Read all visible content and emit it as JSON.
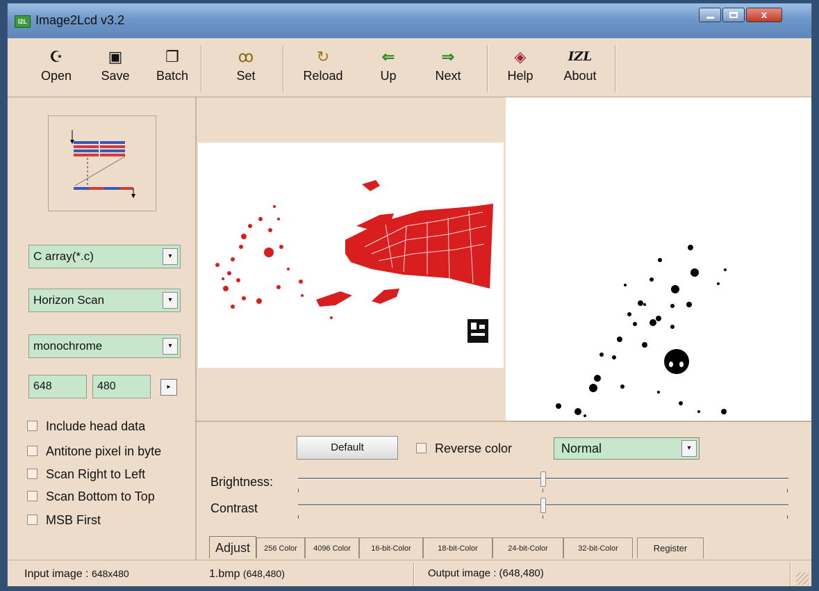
{
  "window": {
    "title": "Image2Lcd v3.2",
    "icon_text": "I2L",
    "close_glyph": "x"
  },
  "toolbar": {
    "buttons": [
      {
        "label": "Open",
        "icon": "open-icon",
        "glyph": "☪"
      },
      {
        "label": "Save",
        "icon": "save-icon",
        "glyph": "▣"
      },
      {
        "label": "Batch",
        "icon": "batch-icon",
        "glyph": "❐"
      },
      {
        "label": "Set",
        "icon": "glasses-icon",
        "glyph": "ꝏ"
      },
      {
        "label": "Reload",
        "icon": "reload-icon",
        "glyph": "↻"
      },
      {
        "label": "Up",
        "icon": "arrow-left-icon",
        "glyph": "⇐"
      },
      {
        "label": "Next",
        "icon": "arrow-right-icon",
        "glyph": "⇒"
      },
      {
        "label": "Help",
        "icon": "help-book-icon",
        "glyph": "◈"
      },
      {
        "label": "About",
        "icon": "about-logo-icon",
        "glyph": "IZL"
      }
    ]
  },
  "left_panel": {
    "output_type": "C array(*.c)",
    "scan_mode": "Horizon Scan",
    "color_depth": "monochrome",
    "width_value": "648",
    "height_value": "480",
    "checkboxes": [
      {
        "label": "Include head data",
        "checked": false
      },
      {
        "label": "Antitone pixel in byte",
        "checked": false
      },
      {
        "label": "Scan Right to Left",
        "checked": false
      },
      {
        "label": "Scan Bottom to Top",
        "checked": false
      },
      {
        "label": "MSB First",
        "checked": false
      }
    ],
    "arrow_glyph": "▾",
    "apply_glyph": "▸"
  },
  "adjust": {
    "default_label": "Default",
    "reverse_label": "Reverse color",
    "reverse_checked": false,
    "mode_value": "Normal",
    "brightness_label": "Brightness:",
    "contrast_label": "Contrast",
    "brightness_level": 0.5,
    "contrast_level": 0.5
  },
  "tabs": [
    {
      "label": "Adjust",
      "active": true
    },
    {
      "label": "256 Color",
      "active": false
    },
    {
      "label": "4096 Color",
      "active": false
    },
    {
      "label": "16-bit-Color",
      "active": false
    },
    {
      "label": "18-bit-Color",
      "active": false
    },
    {
      "label": "24-bit-Color",
      "active": false
    },
    {
      "label": "32-bit-Color",
      "active": false
    },
    {
      "label": "Register",
      "active": false
    }
  ],
  "status": {
    "input_image_label": "Input image :",
    "input_image_size": "648x480",
    "file_name": "1.bmp",
    "file_dims": "(648,480)",
    "output_image": "Output image : (648,480)"
  },
  "colors": {
    "panel_bg": "#eedcca",
    "field_green": "#c6e7cb",
    "image_red": "#d81e1e",
    "titlebar_blue": "#6f97c8"
  }
}
